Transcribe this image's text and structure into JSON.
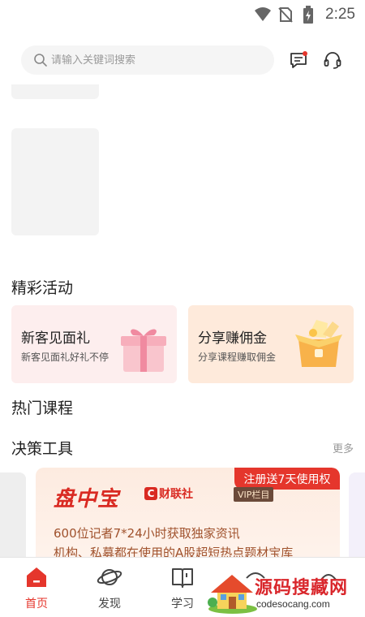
{
  "status_bar": {
    "time": "2:25",
    "icons": [
      "wifi-icon",
      "no-sim-icon",
      "battery-charging-icon"
    ]
  },
  "header": {
    "search_placeholder": "请输入关键词搜索",
    "icons": [
      "message-icon",
      "customer-service-icon"
    ]
  },
  "activities": {
    "title": "精彩活动",
    "cards": [
      {
        "title": "新客见面礼",
        "subtitle": "新客见面礼好礼不停",
        "icon": "gift-box-icon",
        "bg": "#fdeeee"
      },
      {
        "title": "分享赚佣金",
        "subtitle": "分享课程赚取佣金",
        "icon": "treasure-box-icon",
        "bg": "#feeadb"
      }
    ]
  },
  "hot_courses": {
    "title": "热门课程"
  },
  "decision_tools": {
    "title": "决策工具",
    "more": "更多",
    "card": {
      "badge": "注册送7天使用权",
      "logo": "盘中宝",
      "publisher_mark": "C",
      "publisher": "财联社",
      "vip": "VIP栏目",
      "lines": [
        "600位记者7*24小时获取独家资讯",
        "机构、私募都在使用的A股超短热点题材宝库"
      ]
    }
  },
  "bottom_nav": {
    "items": [
      {
        "label": "首页",
        "icon": "home-icon",
        "active": true
      },
      {
        "label": "发现",
        "icon": "planet-icon",
        "active": false
      },
      {
        "label": "学习",
        "icon": "book-icon",
        "active": false
      }
    ]
  },
  "watermark": {
    "title": "源码搜藏网",
    "url": "codesocang.com"
  },
  "colors": {
    "accent": "#e5362c",
    "tool_text": "#a0522d"
  }
}
